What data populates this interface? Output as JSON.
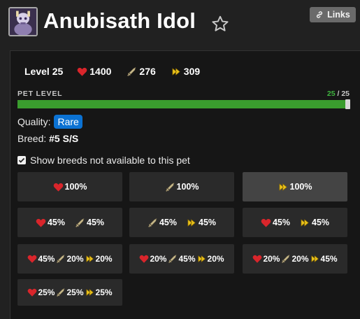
{
  "pet": {
    "name": "Anubisath Idol",
    "level_label": "Level 25",
    "health": "1400",
    "power": "276",
    "speed": "309"
  },
  "header": {
    "links_label": "Links",
    "favorite_icon": "star-outline-icon"
  },
  "pet_level": {
    "label": "PET LEVEL",
    "current": "25",
    "separator": " / ",
    "max": "25",
    "progress_fraction": 1.0
  },
  "quality": {
    "label": "Quality:",
    "value": "Rare",
    "color": "#0b72d3"
  },
  "breed": {
    "label": "Breed:",
    "value": "#5 S/S"
  },
  "show_breeds": {
    "label": "Show breeds not available to this pet",
    "checked": true
  },
  "colors": {
    "health": "#d9252b",
    "power": "#c7b98a",
    "speed": "#e9c21b",
    "progress": "#3a9d2e"
  },
  "breed_options": [
    {
      "stats": [
        {
          "icon": "heart-icon",
          "value": "100%"
        }
      ],
      "selected": false
    },
    {
      "stats": [
        {
          "icon": "sword-icon",
          "value": "100%"
        }
      ],
      "selected": false
    },
    {
      "stats": [
        {
          "icon": "speed-icon",
          "value": "100%"
        }
      ],
      "selected": true
    },
    {
      "stats": [
        {
          "icon": "heart-icon",
          "value": "45%"
        },
        {
          "icon": "sword-icon",
          "value": "45%"
        }
      ],
      "selected": false
    },
    {
      "stats": [
        {
          "icon": "sword-icon",
          "value": "45%"
        },
        {
          "icon": "speed-icon",
          "value": "45%"
        }
      ],
      "selected": false
    },
    {
      "stats": [
        {
          "icon": "heart-icon",
          "value": "45%"
        },
        {
          "icon": "speed-icon",
          "value": "45%"
        }
      ],
      "selected": false
    },
    {
      "stats": [
        {
          "icon": "heart-icon",
          "value": "45%"
        },
        {
          "icon": "sword-icon",
          "value": "20%"
        },
        {
          "icon": "speed-icon",
          "value": "20%"
        }
      ],
      "selected": false
    },
    {
      "stats": [
        {
          "icon": "heart-icon",
          "value": "20%"
        },
        {
          "icon": "sword-icon",
          "value": "45%"
        },
        {
          "icon": "speed-icon",
          "value": "20%"
        }
      ],
      "selected": false
    },
    {
      "stats": [
        {
          "icon": "heart-icon",
          "value": "20%"
        },
        {
          "icon": "sword-icon",
          "value": "20%"
        },
        {
          "icon": "speed-icon",
          "value": "45%"
        }
      ],
      "selected": false
    },
    {
      "stats": [
        {
          "icon": "heart-icon",
          "value": "25%"
        },
        {
          "icon": "sword-icon",
          "value": "25%"
        },
        {
          "icon": "speed-icon",
          "value": "25%"
        }
      ],
      "selected": false
    }
  ]
}
